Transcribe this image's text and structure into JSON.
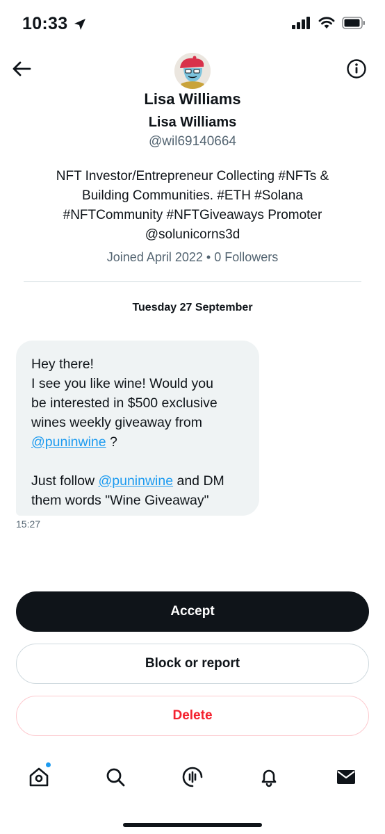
{
  "status_bar": {
    "time": "10:33",
    "location_icon": "location-arrow-icon",
    "signal_icon": "cellular-signal-icon",
    "wifi_icon": "wifi-icon",
    "battery_icon": "battery-icon"
  },
  "header": {
    "back_icon": "back-arrow-icon",
    "info_icon": "info-icon",
    "title": "Lisa Williams"
  },
  "profile": {
    "name": "Lisa Williams",
    "handle": "@wil69140664",
    "bio": "NFT Investor/Entrepreneur Collecting #NFTs &\nBuilding Communities.  #ETH #Solana\n#NFTCommunity #NFTGiveaways Promoter\n@solunicorns3d",
    "meta": "Joined April 2022 • 0 Followers"
  },
  "conversation": {
    "date": "Tuesday 27 September",
    "message": {
      "line1": "Hey there!",
      "line2": "I see you like wine! Would you",
      "line3": "be interested in $500 exclusive",
      "line4": "wines weekly giveaway from",
      "mention1": "@puninwine",
      "line5_suffix": " ?",
      "line6_prefix": "Just follow ",
      "mention2": "@puninwine",
      "line6_suffix": " and DM",
      "line7": "them words \"Wine Giveaway\""
    },
    "time": "15:27"
  },
  "actions": {
    "accept": "Accept",
    "block": "Block or report",
    "delete": "Delete"
  },
  "bottom_nav": {
    "items": [
      {
        "icon": "home-icon"
      },
      {
        "icon": "search-icon"
      },
      {
        "icon": "spaces-icon"
      },
      {
        "icon": "bell-icon"
      },
      {
        "icon": "mail-icon"
      }
    ]
  },
  "colors": {
    "accent": "#1d9bf0",
    "text_primary": "#0f1419",
    "text_secondary": "#536471",
    "bubble_bg": "#eff3f4",
    "danger": "#f4212e"
  }
}
